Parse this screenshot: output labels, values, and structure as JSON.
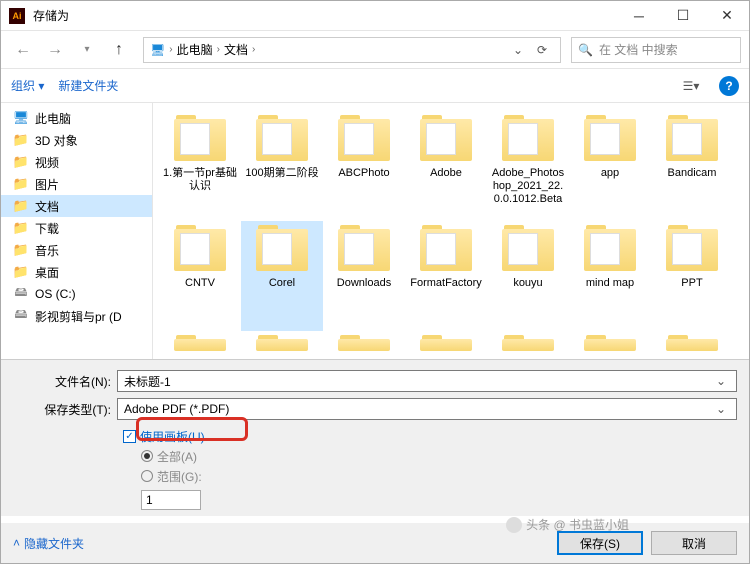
{
  "window": {
    "title": "存储为",
    "app_icon_text": "Ai"
  },
  "nav": {
    "breadcrumb": [
      "此电脑",
      "文档"
    ],
    "search_placeholder": "在 文档 中搜索"
  },
  "toolbar": {
    "organize": "组织 ▾",
    "new_folder": "新建文件夹"
  },
  "sidebar": {
    "items": [
      {
        "label": "此电脑",
        "icon": "pc"
      },
      {
        "label": "3D 对象",
        "icon": "folder"
      },
      {
        "label": "视频",
        "icon": "folder"
      },
      {
        "label": "图片",
        "icon": "folder"
      },
      {
        "label": "文档",
        "icon": "folder",
        "selected": true
      },
      {
        "label": "下载",
        "icon": "folder"
      },
      {
        "label": "音乐",
        "icon": "folder"
      },
      {
        "label": "桌面",
        "icon": "folder"
      },
      {
        "label": "OS (C:)",
        "icon": "drive"
      },
      {
        "label": "影视剪辑与pr (D",
        "icon": "drive"
      }
    ]
  },
  "files": {
    "items": [
      {
        "label": "1.第一节pr基础认识"
      },
      {
        "label": "100期第二阶段"
      },
      {
        "label": "ABCPhoto"
      },
      {
        "label": "Adobe"
      },
      {
        "label": "Adobe_Photoshop_2021_22.0.0.1012.Beta"
      },
      {
        "label": "app"
      },
      {
        "label": "Bandicam"
      },
      {
        "label": "CNTV"
      },
      {
        "label": "Corel",
        "selected": true
      },
      {
        "label": "Downloads"
      },
      {
        "label": "FormatFactory"
      },
      {
        "label": "kouyu"
      },
      {
        "label": "mind map"
      },
      {
        "label": "PPT"
      }
    ]
  },
  "form": {
    "filename_label": "文件名(N):",
    "filename_value": "未标题-1",
    "filetype_label": "保存类型(T):",
    "filetype_value": "Adobe PDF (*.PDF)",
    "use_artboards": "使用画板(U)",
    "all": "全部(A)",
    "range": "范围(G):",
    "range_value": "1"
  },
  "footer": {
    "hide_folders": "隐藏文件夹",
    "save": "保存(S)",
    "cancel": "取消"
  },
  "watermark": "头条 @ 书虫蓝小姐"
}
